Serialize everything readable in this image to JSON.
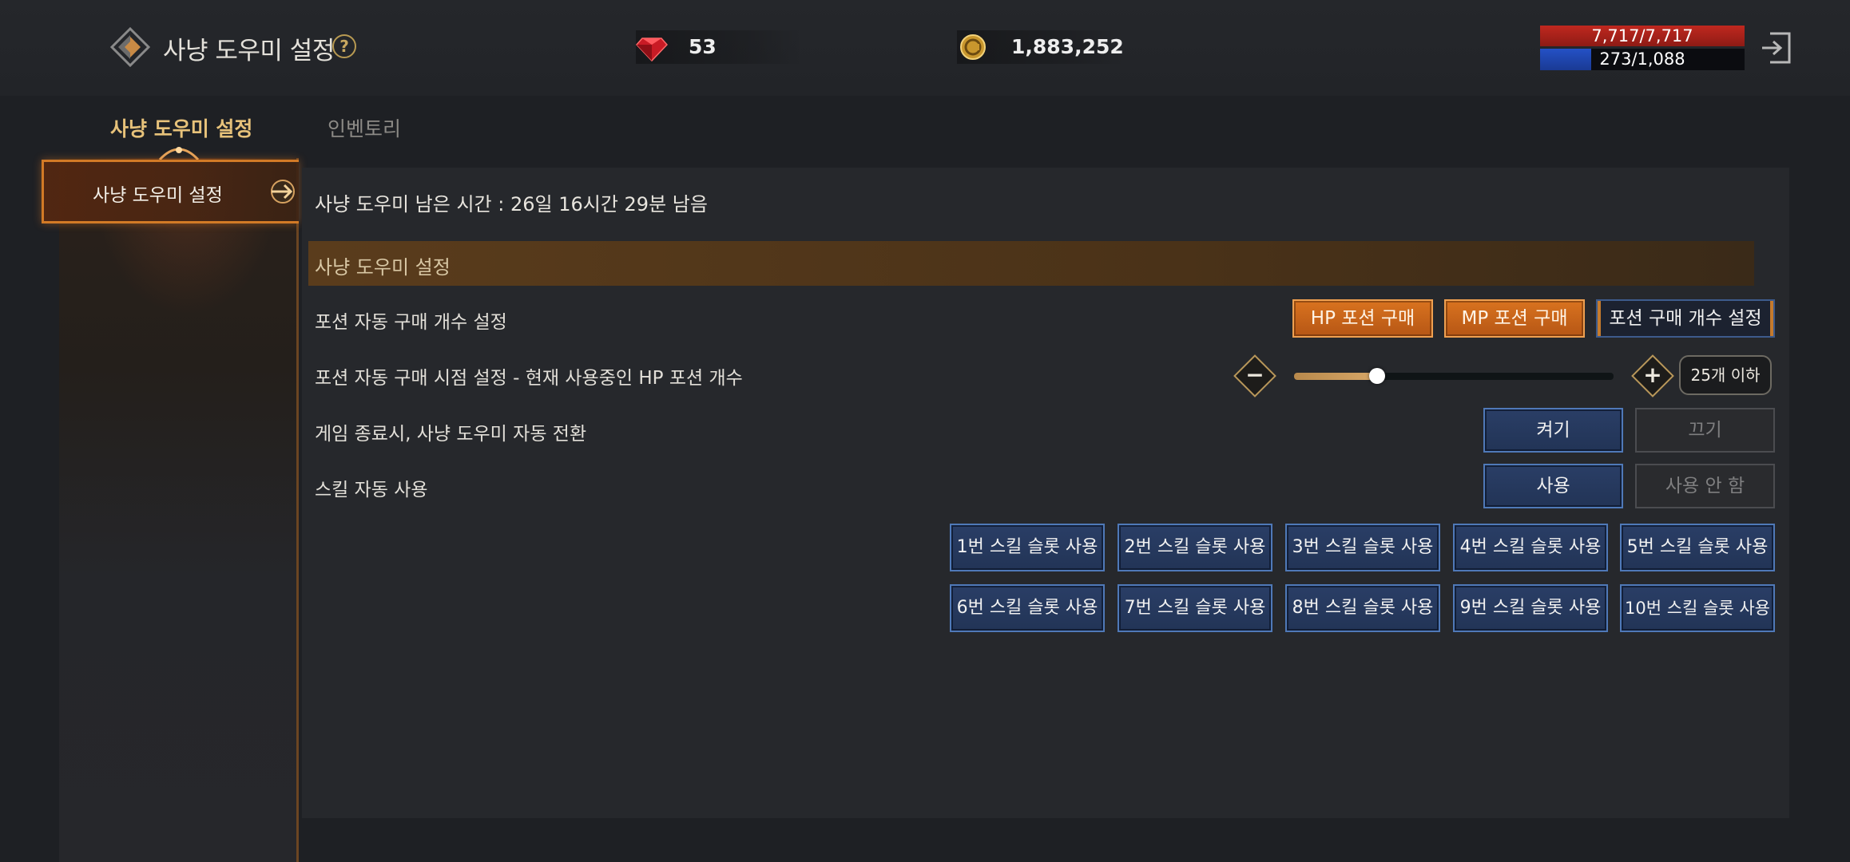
{
  "header": {
    "title": "사냥 도우미 설정",
    "help": "?",
    "gem_count": "53",
    "gold_amount": "1,883,252",
    "hp": {
      "text": "7,717/7,717",
      "fraction": 1.0
    },
    "mp": {
      "text": "273/1,088",
      "fraction": 0.251
    },
    "colors": {
      "hp": "#c0281f",
      "mp": "#2451c6",
      "accent": "#e7c27a"
    }
  },
  "tabs": [
    {
      "label": "사냥 도우미 설정",
      "active": true
    },
    {
      "label": "인벤토리",
      "active": false
    }
  ],
  "sidebar": {
    "items": [
      {
        "label": "사냥 도우미 설정",
        "selected": true
      }
    ]
  },
  "main": {
    "remaining_time": "사냥 도우미 남은 시간 : 26일 16시간 29분 남음",
    "section_title": "사냥 도우미 설정",
    "potion_purchase": {
      "label": "포션 자동 구매 개수 설정",
      "hp_button": "HP 포션 구매",
      "mp_button": "MP 포션 구매",
      "count_button": "포션 구매 개수 설정"
    },
    "potion_timing": {
      "label": "포션 자동 구매 시점 설정 - 현재 사용중인 HP 포션 개수",
      "minus": "−",
      "plus": "+",
      "slider_fraction": 0.26,
      "value_label": "25개 이하"
    },
    "auto_switch": {
      "label": "게임 종료시, 사냥 도우미 자동 전환",
      "on_label": "켜기",
      "off_label": "끄기",
      "selected": "on"
    },
    "auto_skill": {
      "label": "스킬 자동 사용",
      "use_label": "사용",
      "no_use_label": "사용 안 함",
      "selected": "use"
    },
    "skill_slots": [
      "1번 스킬 슬롯 사용",
      "2번 스킬 슬롯 사용",
      "3번 스킬 슬롯 사용",
      "4번 스킬 슬롯 사용",
      "5번 스킬 슬롯 사용",
      "6번 스킬 슬롯 사용",
      "7번 스킬 슬롯 사용",
      "8번 스킬 슬롯 사용",
      "9번 스킬 슬롯 사용",
      "10번 스킬 슬롯 사용"
    ]
  },
  "icons": {
    "logo": "hunting-helper-logo-icon",
    "gem": "red-gem-icon",
    "gold": "gold-coin-icon",
    "exit": "exit-icon"
  }
}
